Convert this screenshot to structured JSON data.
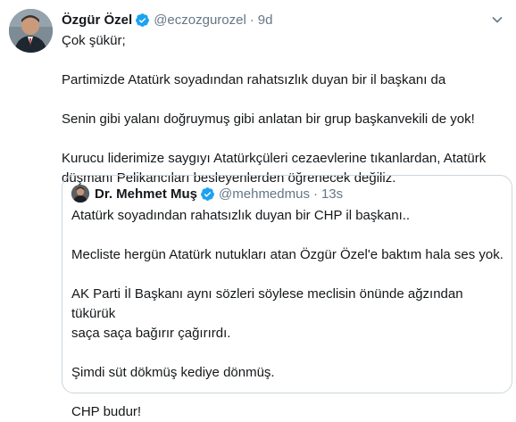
{
  "tweet": {
    "author_name": "Özgür Özel",
    "author_handle": "@eczozgurozel",
    "separator": "·",
    "time": "9d",
    "lines": [
      "Çok şükür;",
      "Partimizde Atatürk soyadından rahatsızlık duyan bir il başkanı da",
      "Senin gibi yalanı doğruymuş gibi anlatan bir grup başkanvekili de yok!",
      "Kurucu liderimize saygıyı Atatürkçüleri cezaevlerine tıkanlardan, Atatürk",
      "düşmanı Pelikancıları besleyenlerden öğrenecek değiliz."
    ]
  },
  "quoted": {
    "author_name": "Dr. Mehmet Muş",
    "author_handle": "@mehmedmus",
    "separator": "·",
    "time": "13s",
    "lines": [
      "Atatürk soyadından rahatsızlık duyan bir CHP il başkanı..",
      "Mecliste hergün Atatürk nutukları atan Özgür Özel'e baktım hala ses yok.",
      "AK Parti İl Başkanı aynı sözleri söylese meclisin önünde ağzından tükürük",
      "saça saça bağırır çağırırdı.",
      "Şimdi süt dökmüş kediye dönmüş.",
      "CHP budur!"
    ]
  },
  "colors": {
    "verified_blue": "#1da1f2",
    "secondary_text": "#657786",
    "border": "#ccd6dd"
  },
  "icons": {
    "verified": "verified-badge-icon",
    "more": "chevron-down-icon"
  }
}
